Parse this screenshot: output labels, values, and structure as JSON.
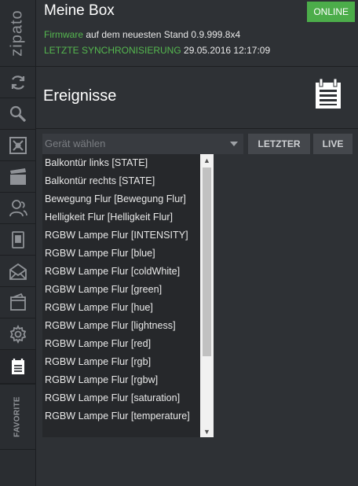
{
  "brand": "zipato",
  "sidebar": {
    "items": [
      {
        "name": "sync-icon",
        "active": false
      },
      {
        "name": "search-icon",
        "active": false
      },
      {
        "name": "network-icon",
        "active": false
      },
      {
        "name": "scenes-icon",
        "active": false
      },
      {
        "name": "users-icon",
        "active": false
      },
      {
        "name": "phone-icon",
        "active": false
      },
      {
        "name": "mail-icon",
        "active": false
      },
      {
        "name": "wallet-icon",
        "active": false
      },
      {
        "name": "gear-icon",
        "active": false
      },
      {
        "name": "events-icon",
        "active": true
      }
    ],
    "favorites_label": "FAVORITE"
  },
  "header": {
    "title": "Meine Box",
    "status": "ONLINE",
    "firmware_label": "Firmware",
    "firmware_text": " auf dem neuesten Stand 0.9.999.8x4",
    "sync_label": "LETZTE SYNCHRONISIERUNG",
    "sync_value": " 29.05.2016 12:17:09"
  },
  "section": {
    "title": "Ereignisse",
    "icon": "calendar-list-icon"
  },
  "filter": {
    "device_placeholder": "Gerät wählen",
    "last_button": "LETZTER",
    "live_button": "LIVE"
  },
  "dropdown": {
    "items": [
      "Balkontür links [STATE]",
      "Balkontür rechts [STATE]",
      "Bewegung Flur [Bewegung Flur]",
      "Helligkeit Flur [Helligkeit Flur]",
      "RGBW Lampe Flur [INTENSITY]",
      "RGBW Lampe Flur [blue]",
      "RGBW Lampe Flur [coldWhite]",
      "RGBW Lampe Flur [green]",
      "RGBW Lampe Flur [hue]",
      "RGBW Lampe Flur [lightness]",
      "RGBW Lampe Flur [red]",
      "RGBW Lampe Flur [rgb]",
      "RGBW Lampe Flur [rgbw]",
      "RGBW Lampe Flur [saturation]",
      "RGBW Lampe Flur [temperature]"
    ]
  },
  "colors": {
    "accent_green": "#4cad4a",
    "label_green": "#55b84f",
    "background": "#2e3135"
  }
}
